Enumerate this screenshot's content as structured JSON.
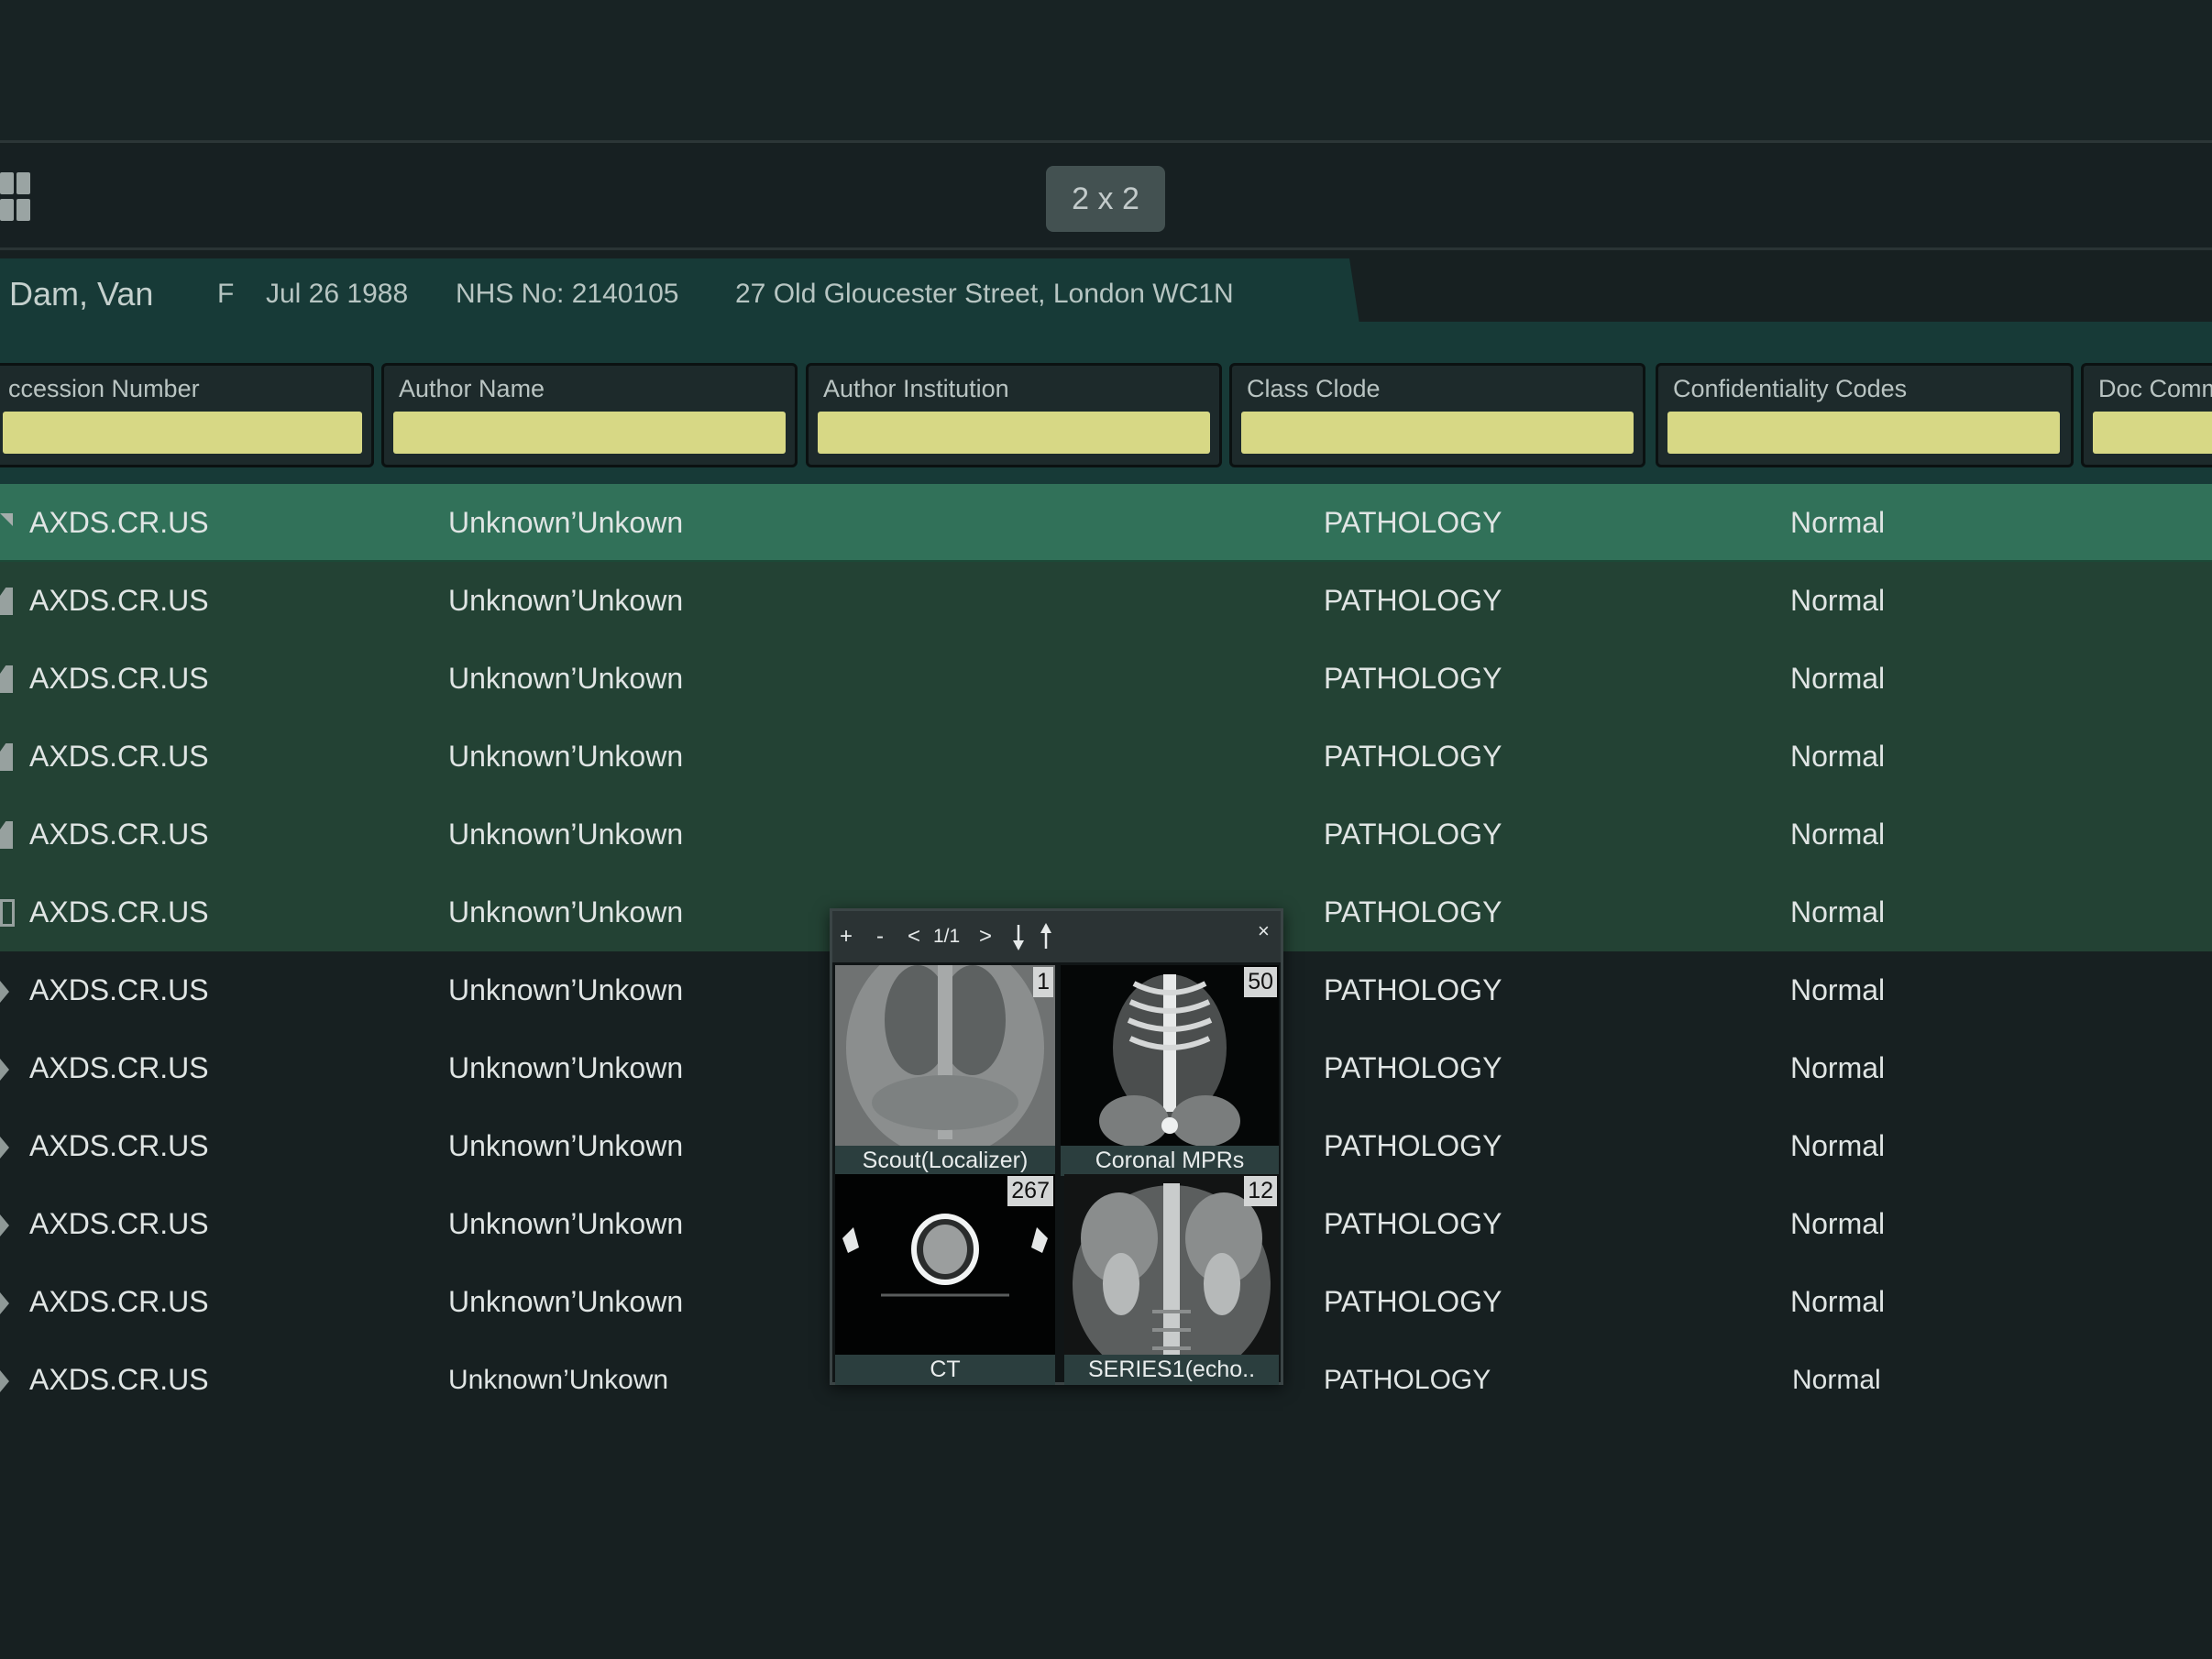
{
  "toolbar": {
    "layout_label": "2 x 2"
  },
  "patient": {
    "name": "Dam, Van",
    "sex": "F",
    "dob": "Jul 26 1988",
    "nhs": "NHS No: 2140105",
    "address": "27 Old Gloucester Street, London WC1N"
  },
  "filters": [
    {
      "label": "ccession Number",
      "value": ""
    },
    {
      "label": "Author Name",
      "value": ""
    },
    {
      "label": "Author Institution",
      "value": ""
    },
    {
      "label": "Class Clode",
      "value": ""
    },
    {
      "label": "Confidentiality Codes",
      "value": ""
    },
    {
      "label": "Doc Comm",
      "value": ""
    }
  ],
  "rows": [
    {
      "accession": "AXDS.CR.US",
      "author": "Unknown’Unkown",
      "class": "PATHOLOGY",
      "confidentiality": "Normal"
    },
    {
      "accession": "AXDS.CR.US",
      "author": "Unknown’Unkown",
      "class": "PATHOLOGY",
      "confidentiality": "Normal"
    },
    {
      "accession": "AXDS.CR.US",
      "author": "Unknown’Unkown",
      "class": "PATHOLOGY",
      "confidentiality": "Normal"
    },
    {
      "accession": "AXDS.CR.US",
      "author": "Unknown’Unkown",
      "class": "PATHOLOGY",
      "confidentiality": "Normal"
    },
    {
      "accession": "AXDS.CR.US",
      "author": "Unknown’Unkown",
      "class": "PATHOLOGY",
      "confidentiality": "Normal"
    },
    {
      "accession": "AXDS.CR.US",
      "author": "Unknown’Unkown",
      "class": "PATHOLOGY",
      "confidentiality": "Normal"
    },
    {
      "accession": "AXDS.CR.US",
      "author": "Unknown’Unkown",
      "class": "PATHOLOGY",
      "confidentiality": "Normal"
    },
    {
      "accession": "AXDS.CR.US",
      "author": "Unknown’Unkown",
      "class": "PATHOLOGY",
      "confidentiality": "Normal"
    },
    {
      "accession": "AXDS.CR.US",
      "author": "Unknown’Unkown",
      "class": "PATHOLOGY",
      "confidentiality": "Normal"
    },
    {
      "accession": "AXDS.CR.US",
      "author": "Unknown’Unkown",
      "class": "PATHOLOGY",
      "confidentiality": "Normal"
    },
    {
      "accession": "AXDS.CR.US",
      "author": "Unknown’Unkown",
      "class": "PATHOLOGY",
      "confidentiality": "Normal"
    },
    {
      "accession": "AXDS.CR.US",
      "author": "Unknown’Unkown",
      "class": "PATHOLOGY",
      "confidentiality": "Normal"
    }
  ],
  "popup": {
    "zoom_in": "+",
    "zoom_out": "-",
    "prev": "<",
    "page": "1/1",
    "next": ">",
    "close": "×",
    "series": [
      {
        "label": "Scout(Localizer)",
        "count": "1"
      },
      {
        "label": "Coronal MPRs",
        "count": "50"
      },
      {
        "label": "CT",
        "count": "267"
      },
      {
        "label": "SERIES1(echo..",
        "count": "12"
      }
    ]
  },
  "colors": {
    "background": "#172021",
    "patient_band": "#173a37",
    "selected_row": "#317159",
    "highlight_row": "#234234",
    "filter_input": "#d7d885"
  },
  "icons": [
    "grid-layout-icon",
    "document-icon",
    "arrow-down-icon",
    "arrow-up-icon",
    "close-icon"
  ]
}
